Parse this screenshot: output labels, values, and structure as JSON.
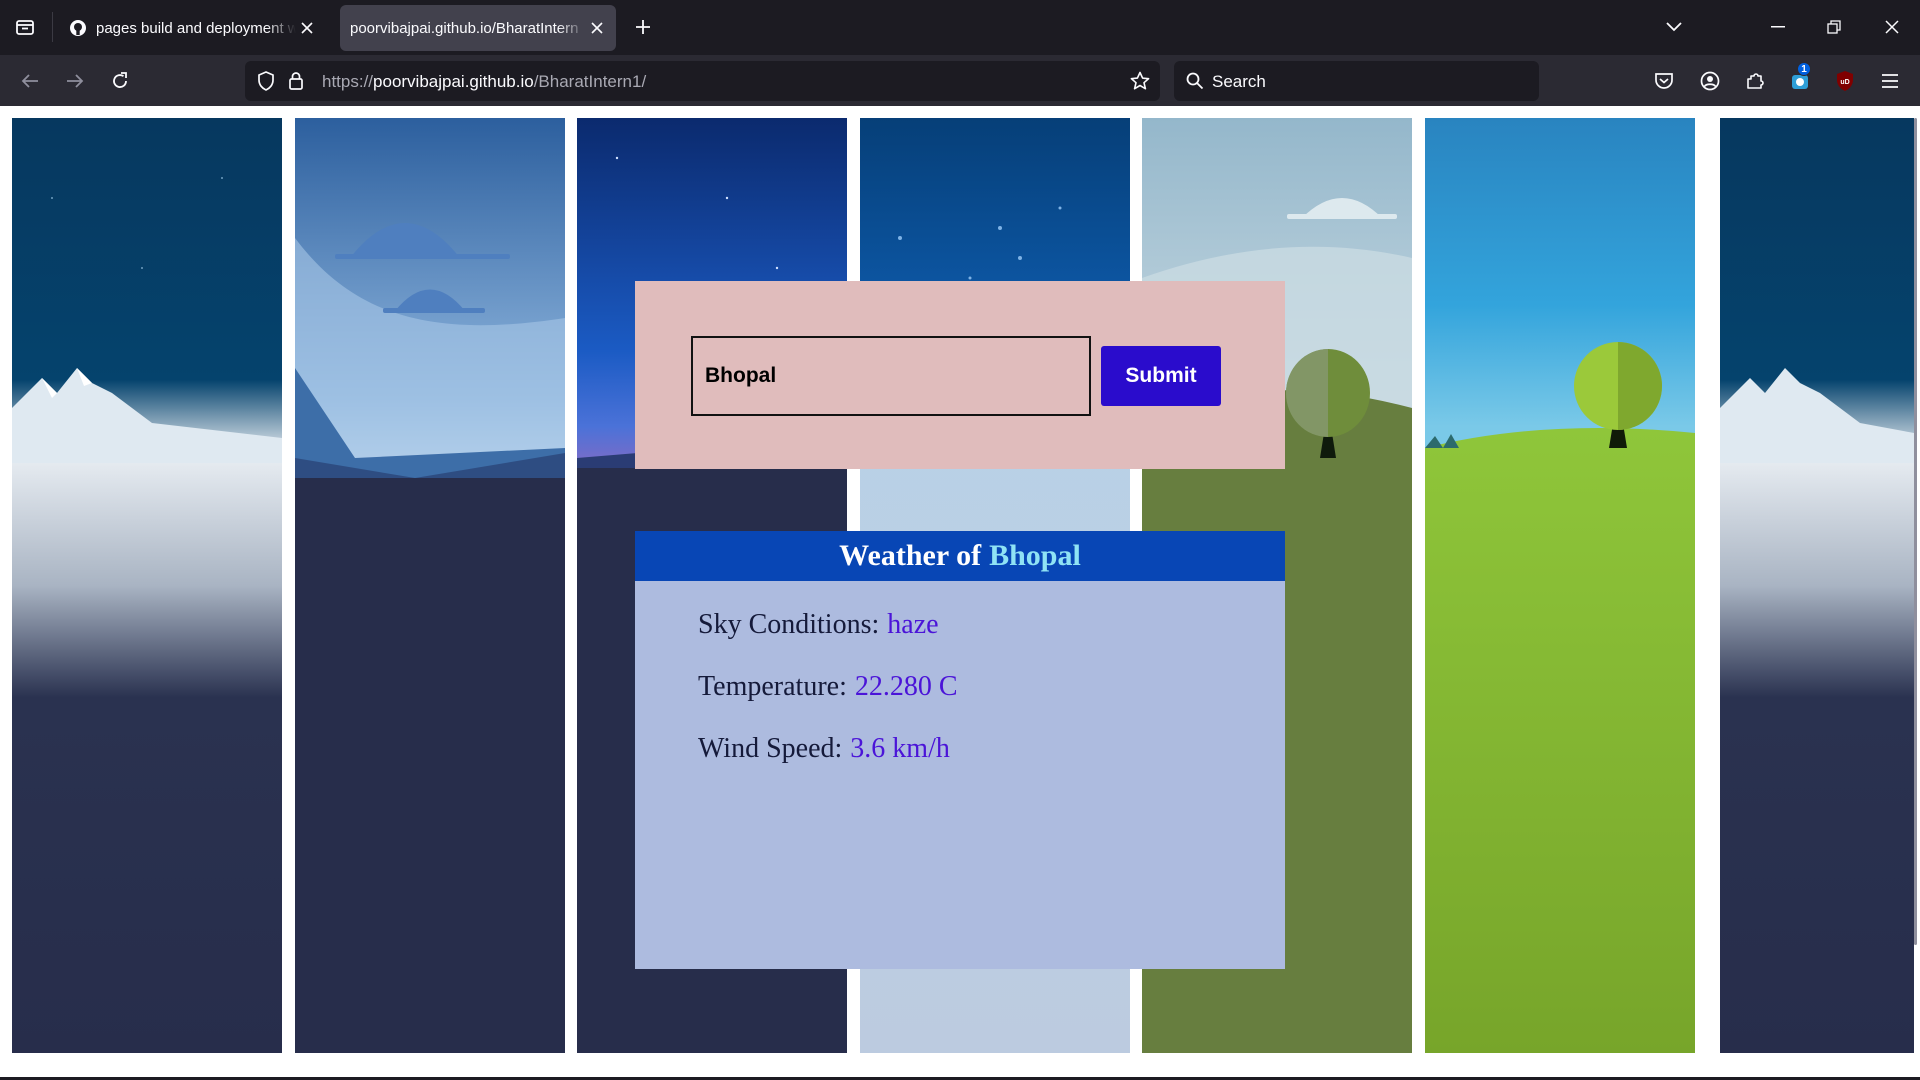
{
  "browser": {
    "tabs": [
      {
        "title": "pages build and deployment w",
        "active": false,
        "icon": "github-icon"
      },
      {
        "title": "poorvibajpai.github.io/BharatIntern",
        "active": true
      }
    ],
    "address_bar": {
      "scheme": "https://",
      "host": "poorvibajpai.github.io",
      "path": "/BharatIntern1/"
    },
    "search_placeholder": "Search",
    "extension_badge": "1"
  },
  "weather_app": {
    "form": {
      "city_value": "Bhopal",
      "submit_label": "Submit"
    },
    "card": {
      "heading_prefix": "Weather of",
      "heading_city": "Bhopal",
      "rows": [
        {
          "label": "Sky Conditions:",
          "value": "haze"
        },
        {
          "label": "Temperature:",
          "value": "22.280 C"
        },
        {
          "label": "Wind Speed:",
          "value": "3.6 km/h"
        }
      ]
    }
  },
  "colors": {
    "form_background": "#e0bcbc",
    "submit_button": "#2a0ccc",
    "card_header": "#0846b5",
    "card_body": "#adbbdf",
    "value_text": "#4b14d8",
    "heading_city": "#8fe3f5"
  }
}
